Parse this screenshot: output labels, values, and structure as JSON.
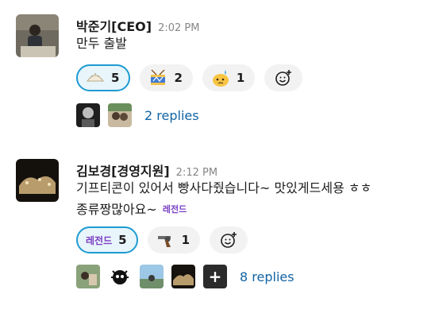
{
  "messages": [
    {
      "author": "박준기[CEO]",
      "time": "2:02 PM",
      "lines": [
        "만두 출발"
      ],
      "reactions": [
        {
          "emoji": "dumpling-emoji",
          "count": "5",
          "mine": true
        },
        {
          "emoji": "drum-emoji",
          "count": "2",
          "mine": false
        },
        {
          "emoji": "sweating-face-emoji",
          "count": "1",
          "mine": false
        }
      ],
      "replies_label": "2 replies"
    },
    {
      "author": "김보경[경영지원]",
      "time": "2:12 PM",
      "lines": [
        "기프티콘이 있어서 빵사다줬습니다~ 맛있게드세용 ㅎㅎ",
        "종류짱많아요~"
      ],
      "inline_emoji_text": "레전드",
      "reactions": [
        {
          "emoji": "legend-emoji",
          "label": "레전드",
          "count": "5",
          "mine": true
        },
        {
          "emoji": "revolver-emoji",
          "count": "1",
          "mine": false
        }
      ],
      "replies_label": "8 replies"
    }
  ],
  "colors": {
    "link": "#1264a3",
    "reaction_selected_border": "#1d9bd1",
    "reaction_selected_bg": "#e8f5fa",
    "timestamp": "#868686"
  }
}
